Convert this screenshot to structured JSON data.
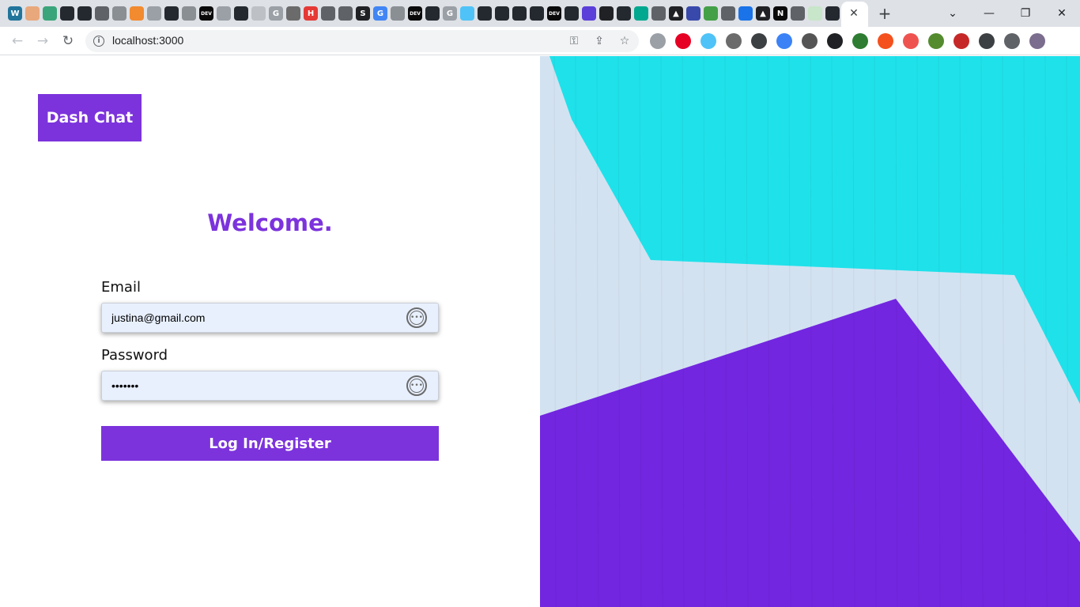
{
  "browser": {
    "url": "localhost:3000",
    "controls": {
      "minimize": "—",
      "restore": "❐",
      "close": "✕",
      "new_tab": "+",
      "tab_close": "✕"
    },
    "favicons": [
      {
        "icon": "wordpress-icon",
        "color": "#21759b",
        "glyph": "W"
      },
      {
        "icon": "avatar-icon",
        "color": "#e8a87c",
        "glyph": ""
      },
      {
        "icon": "app-icon",
        "color": "#3aa57a",
        "glyph": ""
      },
      {
        "icon": "github-icon",
        "color": "#24292f",
        "glyph": ""
      },
      {
        "icon": "github-icon",
        "color": "#24292f",
        "glyph": ""
      },
      {
        "icon": "globe-icon",
        "color": "#5f6368",
        "glyph": ""
      },
      {
        "icon": "globe-icon",
        "color": "#8a8f94",
        "glyph": ""
      },
      {
        "icon": "app-icon",
        "color": "#f28b30",
        "glyph": ""
      },
      {
        "icon": "copyright-icon",
        "color": "#9aa0a6",
        "glyph": ""
      },
      {
        "icon": "github-icon",
        "color": "#24292f",
        "glyph": ""
      },
      {
        "icon": "globe-icon",
        "color": "#8a8f94",
        "glyph": ""
      },
      {
        "icon": "dev-icon",
        "color": "#0a0a0a",
        "glyph": "DEV"
      },
      {
        "icon": "app-icon",
        "color": "#9aa0a6",
        "glyph": ""
      },
      {
        "icon": "github-icon",
        "color": "#24292f",
        "glyph": ""
      },
      {
        "icon": "app-icon",
        "color": "#bdc1c6",
        "glyph": ""
      },
      {
        "icon": "google-icon",
        "color": "#9aa0a6",
        "glyph": "G"
      },
      {
        "icon": "app-icon",
        "color": "#6b6b6b",
        "glyph": ""
      },
      {
        "icon": "hashnode-icon",
        "color": "#e53935",
        "glyph": "H"
      },
      {
        "icon": "globe-icon",
        "color": "#5f6368",
        "glyph": ""
      },
      {
        "icon": "globe-icon",
        "color": "#5f6368",
        "glyph": ""
      },
      {
        "icon": "app-icon",
        "color": "#202124",
        "glyph": "S"
      },
      {
        "icon": "google-icon",
        "color": "#4285f4",
        "glyph": "G"
      },
      {
        "icon": "globe-icon",
        "color": "#8a8f94",
        "glyph": ""
      },
      {
        "icon": "dev-icon",
        "color": "#0a0a0a",
        "glyph": "DEV"
      },
      {
        "icon": "github-icon",
        "color": "#24292f",
        "glyph": ""
      },
      {
        "icon": "google-icon",
        "color": "#9aa0a6",
        "glyph": "G"
      },
      {
        "icon": "app-icon",
        "color": "#4fc3f7",
        "glyph": ""
      },
      {
        "icon": "github-icon",
        "color": "#24292f",
        "glyph": ""
      },
      {
        "icon": "github-icon",
        "color": "#24292f",
        "glyph": ""
      },
      {
        "icon": "github-icon",
        "color": "#24292f",
        "glyph": ""
      },
      {
        "icon": "github-icon",
        "color": "#24292f",
        "glyph": ""
      },
      {
        "icon": "dev-icon",
        "color": "#0a0a0a",
        "glyph": "DEV"
      },
      {
        "icon": "github-icon",
        "color": "#24292f",
        "glyph": ""
      },
      {
        "icon": "app-icon",
        "color": "#5b3fd9",
        "glyph": ""
      },
      {
        "icon": "app-icon",
        "color": "#202124",
        "glyph": ""
      },
      {
        "icon": "github-icon",
        "color": "#24292f",
        "glyph": ""
      },
      {
        "icon": "app-icon",
        "color": "#00a88f",
        "glyph": ""
      },
      {
        "icon": "globe-icon",
        "color": "#5f6368",
        "glyph": ""
      },
      {
        "icon": "app-icon",
        "color": "#202124",
        "glyph": "▲"
      },
      {
        "icon": "app-icon",
        "color": "#3949ab",
        "glyph": ""
      },
      {
        "icon": "app-icon",
        "color": "#43a047",
        "glyph": ""
      },
      {
        "icon": "globe-icon",
        "color": "#5f6368",
        "glyph": ""
      },
      {
        "icon": "gear-icon",
        "color": "#1a73e8",
        "glyph": ""
      },
      {
        "icon": "app-icon",
        "color": "#202124",
        "glyph": "▲"
      },
      {
        "icon": "notion-icon",
        "color": "#0a0a0a",
        "glyph": "N"
      },
      {
        "icon": "globe-icon",
        "color": "#5f6368",
        "glyph": ""
      },
      {
        "icon": "app-icon",
        "color": "#c8e6c9",
        "glyph": ""
      },
      {
        "icon": "github-icon",
        "color": "#24292f",
        "glyph": ""
      },
      {
        "icon": "globe-icon",
        "color": "#8a8f94",
        "glyph": ""
      }
    ],
    "extensions": [
      {
        "icon": "headphones-icon",
        "color": "#9aa0a6"
      },
      {
        "icon": "pinterest-icon",
        "color": "#e60023"
      },
      {
        "icon": "shield-icon",
        "color": "#4fc3f7"
      },
      {
        "icon": "app-icon",
        "color": "#6b6b6b"
      },
      {
        "icon": "sync-icon",
        "color": "#3c4043"
      },
      {
        "icon": "app-icon",
        "color": "#3b82f6"
      },
      {
        "icon": "wordpress-icon",
        "color": "#555"
      },
      {
        "icon": "app-icon",
        "color": "#202124"
      },
      {
        "icon": "globe-icon",
        "color": "#2e7d32"
      },
      {
        "icon": "fire-icon",
        "color": "#f4511e"
      },
      {
        "icon": "app-icon",
        "color": "#ef5350"
      },
      {
        "icon": "app-icon",
        "color": "#558b2f"
      },
      {
        "icon": "app-icon",
        "color": "#c62828"
      },
      {
        "icon": "pen-icon",
        "color": "#3c4043"
      },
      {
        "icon": "puzzle-icon",
        "color": "#5f6368"
      },
      {
        "icon": "profile-avatar-icon",
        "color": "#7b6d8d"
      }
    ]
  },
  "page": {
    "brand": "Dash Chat",
    "heading": "Welcome.",
    "email_label": "Email",
    "email_value": "justina@gmail.com",
    "password_label": "Password",
    "password_value": "•••••••",
    "submit_label": "Log In/Register",
    "keypass_glyph": "•••"
  },
  "colors": {
    "accent": "#7c33dc",
    "input_bg": "#e8f0fe",
    "art_cyan": "#1fe1ea",
    "art_light": "#d3e2f1",
    "art_purple": "#7226e0"
  }
}
